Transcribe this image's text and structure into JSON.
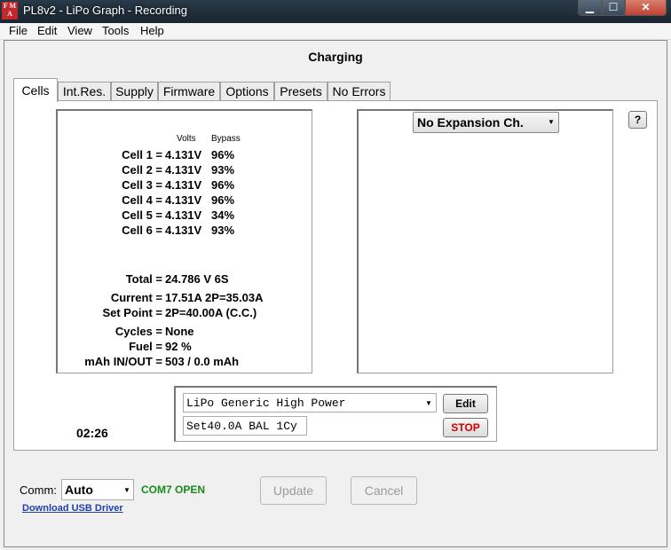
{
  "window": {
    "title": "PL8v2 - LiPo Graph - Recording",
    "app_icon_text": "FMA",
    "controls": {
      "minimize": "▁",
      "maximize": "☐",
      "close": "✕"
    }
  },
  "menu": [
    "File",
    "Edit",
    "View",
    "Tools",
    "Help"
  ],
  "heading": "Charging",
  "tabs": [
    "Cells",
    "Int.Res.",
    "Supply",
    "Firmware",
    "Options",
    "Presets",
    "No Errors"
  ],
  "cells": {
    "col_volts": "Volts",
    "col_bypass": "Bypass",
    "rows": [
      {
        "label": "Cell 1 =",
        "volts": "4.131V",
        "bypass": "96%"
      },
      {
        "label": "Cell 2 =",
        "volts": "4.131V",
        "bypass": "93%"
      },
      {
        "label": "Cell 3 =",
        "volts": "4.131V",
        "bypass": "96%"
      },
      {
        "label": "Cell 4 =",
        "volts": "4.131V",
        "bypass": "96%"
      },
      {
        "label": "Cell 5 =",
        "volts": "4.131V",
        "bypass": "34%"
      },
      {
        "label": "Cell 6 =",
        "volts": "4.131V",
        "bypass": "93%"
      }
    ],
    "stats": [
      {
        "label": "Total =",
        "value": "24.786 V  6S"
      },
      {
        "label": "Current =",
        "value": "17.51A  2P=35.03A"
      },
      {
        "label": "Set Point =",
        "value": "2P=40.00A  (C.C.)"
      },
      {
        "label": "Cycles =",
        "value": "None"
      },
      {
        "label": "Fuel =",
        "value": "92 %"
      },
      {
        "label": "mAh IN/OUT =",
        "value": "503 / 0.0 mAh"
      }
    ]
  },
  "expansion": {
    "selected": "No Expansion Ch.",
    "help_label": "?"
  },
  "profile": {
    "selected": "LiPo Generic High Power",
    "settings": "Set40.0A BAL 1Cy",
    "edit_label": "Edit",
    "stop_label": "STOP",
    "stop_color": "#d00000"
  },
  "timer": "02:26",
  "bottom": {
    "comm_label": "Comm:",
    "comm_value": "Auto",
    "status": "COM7 OPEN",
    "status_color": "#1a8a1a",
    "update_label": "Update",
    "cancel_label": "Cancel",
    "driver_link": "Download USB Driver"
  }
}
